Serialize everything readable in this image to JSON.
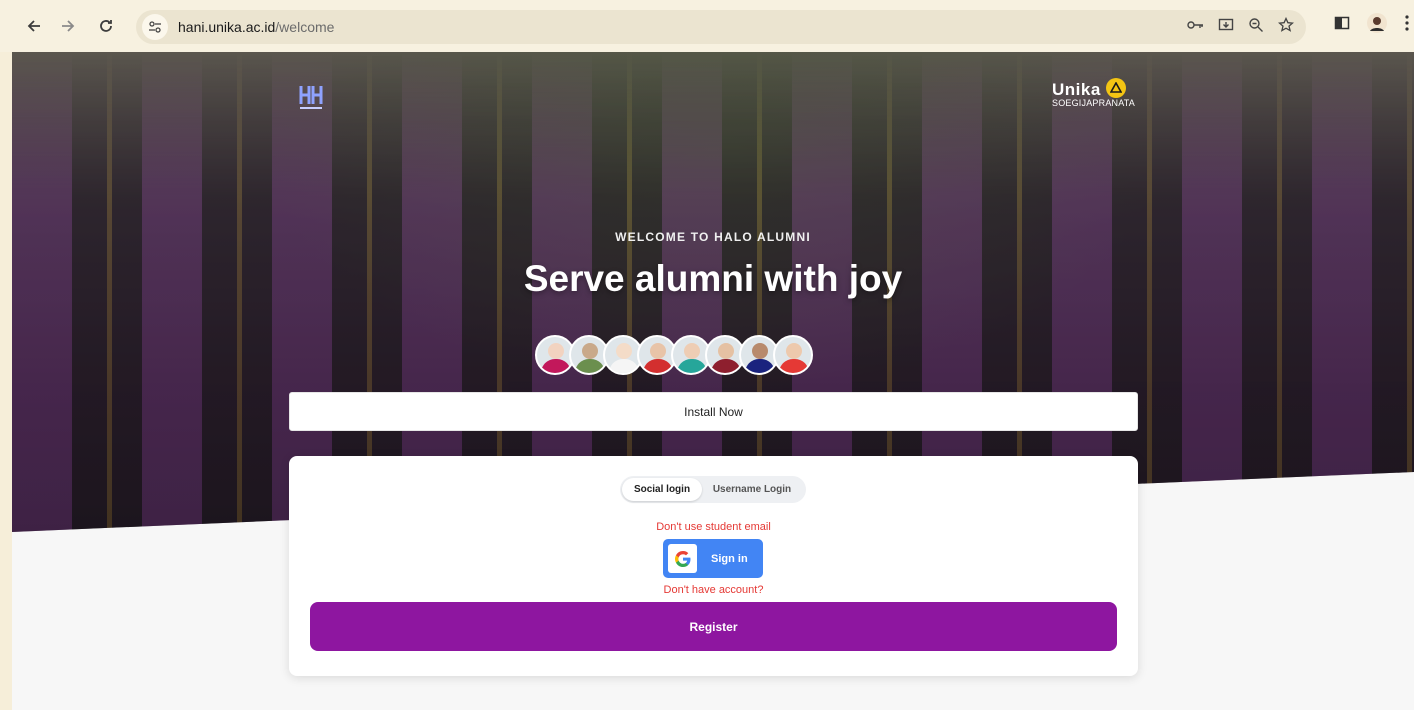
{
  "browser": {
    "url_host": "hani.unika.ac.id",
    "url_path": "/welcome"
  },
  "hero": {
    "overline": "WELCOME TO HALO ALUMNI",
    "headline": "Serve alumni with joy",
    "right_logo_word": "Unika",
    "right_logo_sub": "SOEGIJAPRANATA"
  },
  "avatars": [
    {
      "name": "alumni-avatar-1",
      "head": "#f2d3c0",
      "body": "#c2185b"
    },
    {
      "name": "alumni-avatar-2",
      "head": "#c9a98a",
      "body": "#6b8f4e"
    },
    {
      "name": "alumni-avatar-3",
      "head": "#f4dcc8",
      "body": "#f5f5f5"
    },
    {
      "name": "alumni-avatar-4",
      "head": "#e8c4a8",
      "body": "#d32f2f"
    },
    {
      "name": "alumni-avatar-5",
      "head": "#eecdb4",
      "body": "#26a69a"
    },
    {
      "name": "alumni-avatar-6",
      "head": "#e5c1a3",
      "body": "#8e1f2e"
    },
    {
      "name": "alumni-avatar-7",
      "head": "#b88a6c",
      "body": "#1a237e"
    },
    {
      "name": "alumni-avatar-8",
      "head": "#edc9ad",
      "body": "#e53935"
    }
  ],
  "install": {
    "label": "Install Now"
  },
  "login": {
    "tab_social": "Social login",
    "tab_username": "Username Login",
    "warning": "Don't use student email",
    "google_label": "Sign in",
    "no_account": "Don't have account?",
    "register_label": "Register"
  },
  "colors": {
    "register": "#8e16a0",
    "google": "#4285f4",
    "warning": "#e53935"
  }
}
